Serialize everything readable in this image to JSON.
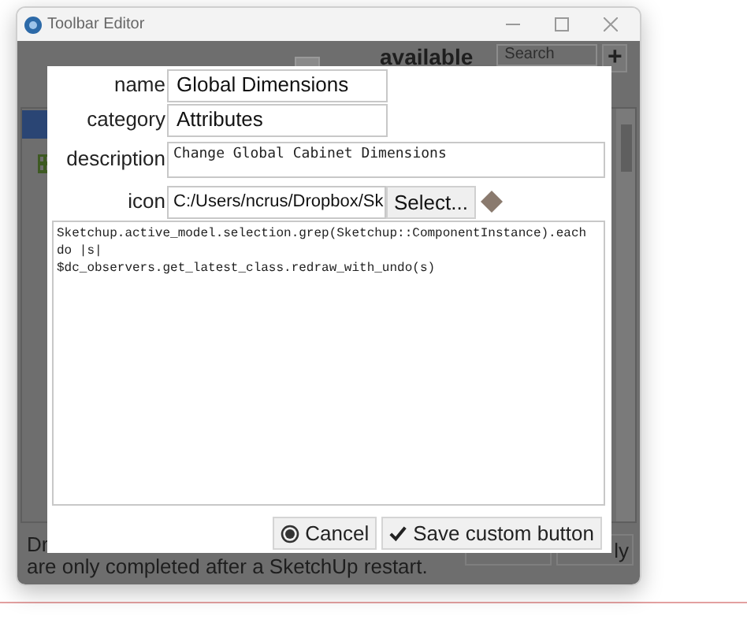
{
  "window": {
    "title": "Toolbar Editor"
  },
  "background": {
    "heading": "available",
    "search": {
      "placeholder": "Search"
    },
    "add_button": "+",
    "footer_text_1": "Dr",
    "footer_text_2": "are only completed after a SketchUp restart.",
    "footer_button": "ly"
  },
  "dialog": {
    "fields": [
      {
        "label": "name",
        "kind": "input",
        "value": "Global Dimensions"
      },
      {
        "label": "category",
        "kind": "input",
        "value": "Attributes"
      },
      {
        "label": "description",
        "kind": "textarea",
        "value": "Change Global Cabinet Dimensions"
      },
      {
        "label": "icon",
        "kind": "file",
        "value": "C:/Users/ncrus/Dropbox/Sk",
        "button": "Select..."
      }
    ],
    "code_lines": [
      "Sketchup.active_model.selection.grep(Sketchup::ComponentInstance).each",
      "do |s|",
      "$dc_observers.get_latest_class.redraw_with_undo(s)"
    ],
    "buttons": [
      {
        "label": "Cancel",
        "kind": "cancel"
      },
      {
        "label": "Save custom button",
        "kind": "save"
      }
    ]
  }
}
